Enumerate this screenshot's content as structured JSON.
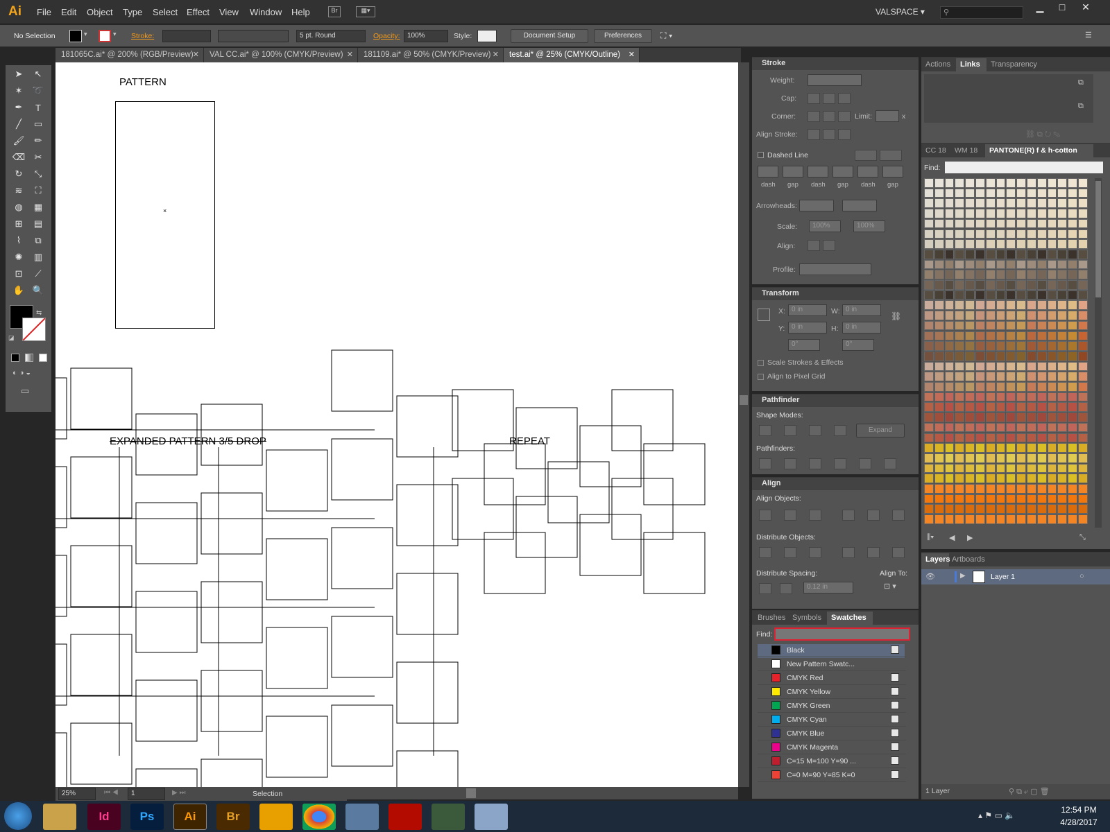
{
  "app": {
    "logo": "Ai",
    "workspace": "VALSPACE",
    "menus": [
      "File",
      "Edit",
      "Object",
      "Type",
      "Select",
      "Effect",
      "View",
      "Window",
      "Help"
    ]
  },
  "control_bar": {
    "selection": "No Selection",
    "stroke_label": "Stroke:",
    "brush": "5 pt. Round",
    "opacity_label": "Opacity:",
    "opacity": "100%",
    "style_label": "Style:",
    "doc_setup": "Document Setup",
    "preferences": "Preferences"
  },
  "tabs": [
    {
      "label": "181065C.ai* @ 200% (RGB/Preview)"
    },
    {
      "label": "VAL CC.ai* @ 100% (CMYK/Preview)"
    },
    {
      "label": "181109.ai* @ 50% (CMYK/Preview)"
    },
    {
      "label": "test.ai* @ 25% (CMYK/Outline)"
    }
  ],
  "artboard": {
    "pattern_label": "PATTERN",
    "expanded_label": "EXPANDED PATTERN 3/5 DROP",
    "repeat_label": "REPEAT"
  },
  "stroke_panel": {
    "title": "Stroke",
    "weight": "Weight:",
    "cap": "Cap:",
    "corner": "Corner:",
    "limit": "Limit:",
    "limit_unit": "x",
    "align_stroke": "Align Stroke:",
    "dashed": "Dashed Line",
    "dash": "dash",
    "gap": "gap",
    "arrowheads": "Arrowheads:",
    "scale": "Scale:",
    "scale_v1": "100%",
    "scale_v2": "100%",
    "align": "Align:",
    "profile": "Profile:"
  },
  "transform_panel": {
    "title": "Transform",
    "x": "X:",
    "y": "Y:",
    "w": "W:",
    "h": "H:",
    "xv": "0 in",
    "yv": "0 in",
    "wv": "0 in",
    "hv": "0 in",
    "ang1": "0°",
    "ang2": "0°",
    "scale_strokes": "Scale Strokes & Effects",
    "align_pixel": "Align to Pixel Grid"
  },
  "pathfinder_panel": {
    "title": "Pathfinder",
    "shape_modes": "Shape Modes:",
    "expand": "Expand",
    "pathfinders": "Pathfinders:"
  },
  "align_panel": {
    "title": "Align",
    "align_objects": "Align Objects:",
    "distribute_objects": "Distribute Objects:",
    "distribute_spacing": "Distribute Spacing:",
    "align_to": "Align To:",
    "spacing_value": "0.12 in"
  },
  "swatch_panel": {
    "tabs": [
      "Brushes",
      "Symbols",
      "Swatches"
    ],
    "find": "Find:",
    "items": [
      {
        "name": "Black",
        "color": "#000000"
      },
      {
        "name": "New Pattern Swatc...",
        "color": "#ffffff"
      },
      {
        "name": "CMYK Red",
        "color": "#e8222b"
      },
      {
        "name": "CMYK Yellow",
        "color": "#ffea00"
      },
      {
        "name": "CMYK Green",
        "color": "#00a650"
      },
      {
        "name": "CMYK Cyan",
        "color": "#00aeef"
      },
      {
        "name": "CMYK Blue",
        "color": "#2e3192"
      },
      {
        "name": "CMYK Magenta",
        "color": "#ec008c"
      },
      {
        "name": "C=15 M=100 Y=90 ...",
        "color": "#be1e2d"
      },
      {
        "name": "C=0 M=90 Y=85 K=0",
        "color": "#ef4136"
      }
    ]
  },
  "right_top_tabs": [
    "Actions",
    "Links",
    "Transparency"
  ],
  "pantone_tabs": [
    "CC 18",
    "WM 18",
    "PANTONE(R) f & h-cotton"
  ],
  "pantone_find": "Find:",
  "layers_panel": {
    "tabs": [
      "Layers",
      "Artboards"
    ],
    "layer": "Layer 1",
    "count": "1 Layer"
  },
  "status": {
    "zoom": "25%",
    "page": "1",
    "tool": "Selection"
  },
  "clock": {
    "time": "12:54 PM",
    "date": "4/28/2017"
  },
  "taskbar_apps": [
    "Id",
    "Ps",
    "Ai",
    "Br",
    "Ol",
    "Ch",
    "Pt",
    "Ac",
    "Cl",
    "Ca"
  ]
}
